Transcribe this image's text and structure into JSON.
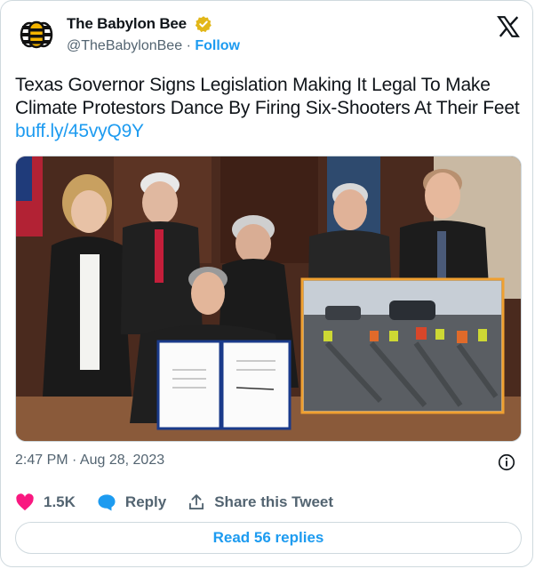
{
  "account": {
    "display_name": "The Babylon Bee",
    "handle": "@TheBabylonBee",
    "separator": "·",
    "follow_label": "Follow"
  },
  "tweet": {
    "text": "Texas Governor Signs Legislation Making It Legal To Make Climate Protestors Dance By Firing Six-Shooters At Their Feet",
    "link": "buff.ly/45vyQ9Y",
    "timestamp": "2:47 PM · Aug 28, 2023"
  },
  "actions": {
    "likes": "1.5K",
    "reply_label": "Reply",
    "share_label": "Share this Tweet"
  },
  "read_replies_label": "Read 56 replies",
  "colors": {
    "brand_blue": "#1d9bf0",
    "like_red": "#f91880",
    "verified_gold": "#e2b719",
    "inset_border": "#f0a030"
  },
  "icons": [
    "bee-logo-icon",
    "verified-badge-icon",
    "x-logo-icon",
    "info-icon",
    "heart-icon",
    "reply-bubble-icon",
    "share-icon"
  ]
}
